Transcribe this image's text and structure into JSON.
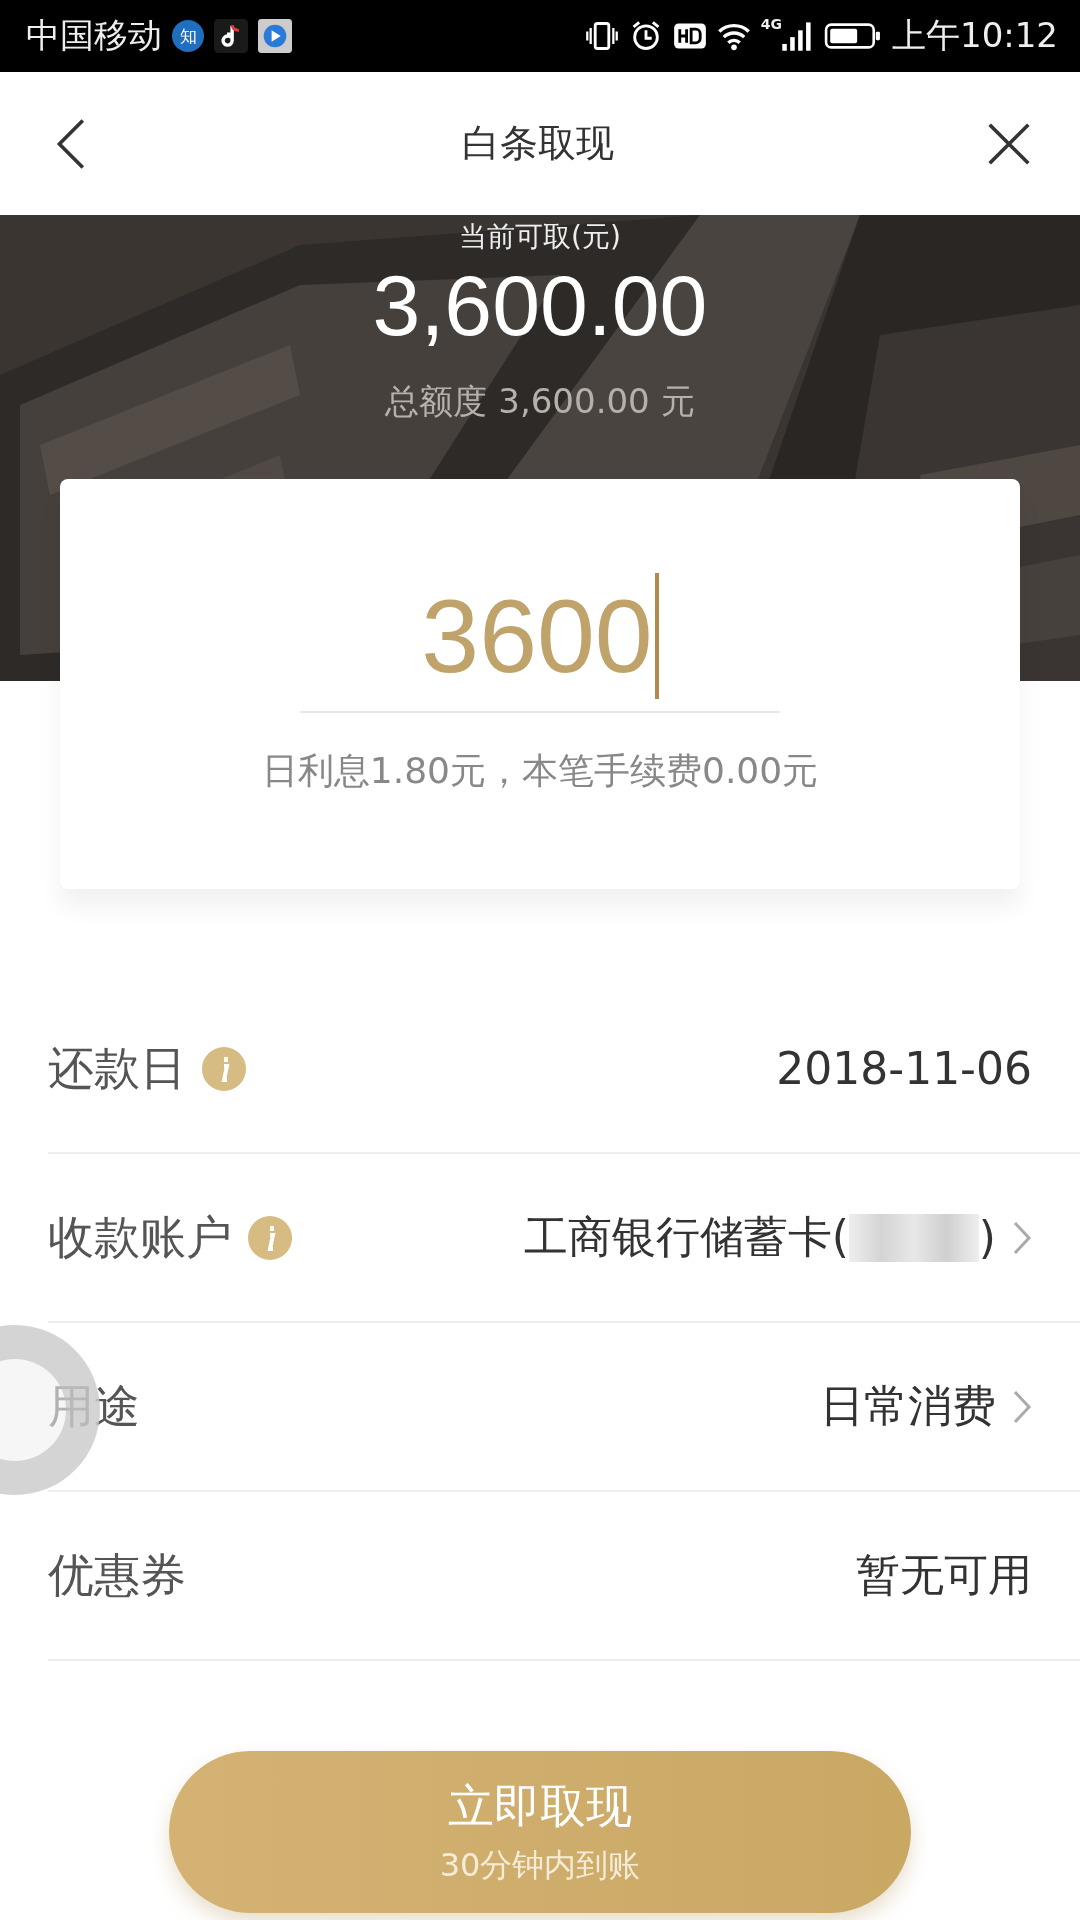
{
  "status_bar": {
    "carrier": "中国移动",
    "app_badge": "知",
    "time": "上午10:12",
    "network": "4G"
  },
  "header": {
    "title": "白条取现"
  },
  "summary": {
    "label": "当前可取(元)",
    "available": "3,600.00",
    "total": "总额度 3,600.00 元"
  },
  "amount_field": {
    "value": "3600",
    "note": "日利息1.80元，本笔手续费0.00元"
  },
  "rows": [
    {
      "label": "还款日",
      "info": true,
      "value": "2018-11-06",
      "arrow": false,
      "masked": false
    },
    {
      "label": "收款账户",
      "info": true,
      "value": "工商银行储蓄卡(",
      "value_end": ")",
      "arrow": true,
      "masked": true
    },
    {
      "label": "用途",
      "info": false,
      "value": "日常消费",
      "arrow": true,
      "masked": false
    },
    {
      "label": "优惠券",
      "info": false,
      "value": "暂无可用",
      "arrow": false,
      "masked": false
    }
  ],
  "submit": {
    "label": "立即取现",
    "sublabel": "30分钟内到账"
  }
}
